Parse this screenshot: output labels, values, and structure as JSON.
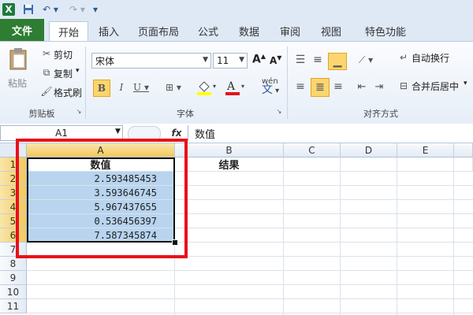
{
  "app_logo": "X",
  "tabs": [
    "文件",
    "开始",
    "插入",
    "页面布局",
    "公式",
    "数据",
    "审阅",
    "视图",
    "特色功能"
  ],
  "clipboard": {
    "paste": "粘贴",
    "cut": "剪切",
    "copy": "复制",
    "format_painter": "格式刷",
    "group": "剪贴板"
  },
  "font": {
    "name": "宋体",
    "size": "11",
    "group": "字体",
    "wen": "文"
  },
  "alignment": {
    "wrap": "自动换行",
    "merge": "合并后居中",
    "group": "对齐方式"
  },
  "name_box": "A1",
  "fx_label": "fx",
  "formula_value": "数值",
  "columns": [
    "A",
    "B",
    "C",
    "D",
    "E"
  ],
  "rows": [
    "1",
    "2",
    "3",
    "4",
    "5",
    "6",
    "7",
    "8",
    "9",
    "10",
    "11"
  ],
  "cells": {
    "a1": "数值",
    "b1": "结果",
    "values": [
      "2.593485453",
      "3.593646745",
      "5.967437655",
      "0.536456397",
      "7.587345874"
    ]
  },
  "colors": {
    "file_tab": "#2e7d32",
    "selection": "#b8d4ef",
    "highlight_border": "#e8101a",
    "header_selected": "#f3c85e"
  }
}
